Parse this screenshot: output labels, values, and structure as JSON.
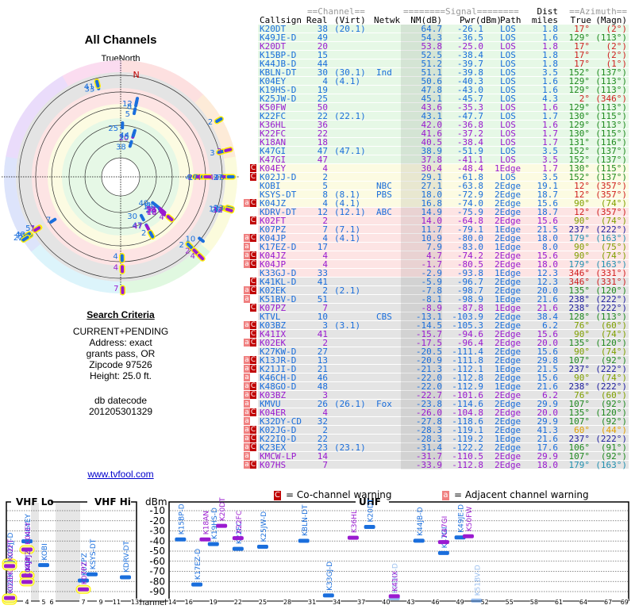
{
  "polar": {
    "title": "All Channels",
    "north_label": "TrueNorth",
    "magnetic_north_label": "N"
  },
  "criteria": {
    "heading": "Search Criteria",
    "lines": [
      "CURRENT+PENDING",
      "Address: exact",
      "grants pass, OR",
      "Zipcode 97526",
      "Height: 25.0 ft."
    ],
    "db_label": "db datecode",
    "db_value": "201205301329"
  },
  "site_link": "www.tvfool.com",
  "table_header": {
    "channel_group": "==Channel==",
    "signal_group": "========Signal========",
    "dist_top": "Dist",
    "azimuth_group": "==Azimuth==",
    "callsign": "Callsign",
    "real": "Real",
    "virt": "(Virt)",
    "netwk": "Netwk",
    "nm": "NM(dB)",
    "pwr": "Pwr(dBm)",
    "path": "Path",
    "dist": "miles",
    "true": "True",
    "magn": "(Magn)"
  },
  "colors": {
    "blue": "#1a6edc",
    "purple": "#9a1ad0",
    "green_zone": "#e6f8e6",
    "yellow_zone": "#fcfbe2",
    "pink_zone": "#fde4e4",
    "gray_zone": "#e4e4e4",
    "co_channel": "#c00000",
    "adjacent": "#f08080"
  },
  "stations": [
    {
      "call": "K20DT",
      "real": "38",
      "virt": "(20.1)",
      "net": "",
      "nm": "64.7",
      "pwr": "-26.1",
      "path": "LOS",
      "dist": "1.8",
      "az": "17°",
      "magn": "(2°)",
      "flags": "",
      "color": "blue"
    },
    {
      "call": "K49JE-D",
      "real": "49",
      "virt": "",
      "net": "",
      "nm": "54.3",
      "pwr": "-36.5",
      "path": "LOS",
      "dist": "1.6",
      "az": "129°",
      "magn": "(113°)",
      "flags": "",
      "color": "blue"
    },
    {
      "call": "K20DT",
      "real": "20",
      "virt": "",
      "net": "",
      "nm": "53.8",
      "pwr": "-25.0",
      "path": "LOS",
      "dist": "1.8",
      "az": "17°",
      "magn": "(2°)",
      "flags": "",
      "color": "purple"
    },
    {
      "call": "K15BP-D",
      "real": "15",
      "virt": "",
      "net": "",
      "nm": "52.5",
      "pwr": "-38.4",
      "path": "LOS",
      "dist": "1.8",
      "az": "17°",
      "magn": "(2°)",
      "flags": "",
      "color": "blue"
    },
    {
      "call": "K44JB-D",
      "real": "44",
      "virt": "",
      "net": "",
      "nm": "51.2",
      "pwr": "-39.7",
      "path": "LOS",
      "dist": "1.8",
      "az": "17°",
      "magn": "(1°)",
      "flags": "",
      "color": "blue"
    },
    {
      "call": "KBLN-DT",
      "real": "30",
      "virt": "(30.1)",
      "net": "Ind",
      "nm": "51.1",
      "pwr": "-39.8",
      "path": "LOS",
      "dist": "3.5",
      "az": "152°",
      "magn": "(137°)",
      "flags": "",
      "color": "blue"
    },
    {
      "call": "K04EY",
      "real": "4",
      "virt": "(4.1)",
      "net": "",
      "nm": "50.6",
      "pwr": "-40.3",
      "path": "LOS",
      "dist": "1.6",
      "az": "129°",
      "magn": "(113°)",
      "flags": "",
      "color": "blue"
    },
    {
      "call": "K19HS-D",
      "real": "19",
      "virt": "",
      "net": "",
      "nm": "47.8",
      "pwr": "-43.0",
      "path": "LOS",
      "dist": "1.6",
      "az": "129°",
      "magn": "(113°)",
      "flags": "",
      "color": "blue"
    },
    {
      "call": "K25JW-D",
      "real": "25",
      "virt": "",
      "net": "",
      "nm": "45.1",
      "pwr": "-45.7",
      "path": "LOS",
      "dist": "4.3",
      "az": "2°",
      "magn": "(346°)",
      "flags": "",
      "color": "blue"
    },
    {
      "call": "K50FW",
      "real": "50",
      "virt": "",
      "net": "",
      "nm": "43.6",
      "pwr": "-35.3",
      "path": "LOS",
      "dist": "1.6",
      "az": "129°",
      "magn": "(113°)",
      "flags": "",
      "color": "purple"
    },
    {
      "call": "K22FC",
      "real": "22",
      "virt": "(22.1)",
      "net": "",
      "nm": "43.1",
      "pwr": "-47.7",
      "path": "LOS",
      "dist": "1.7",
      "az": "130°",
      "magn": "(115°)",
      "flags": "",
      "color": "blue"
    },
    {
      "call": "K36HL",
      "real": "36",
      "virt": "",
      "net": "",
      "nm": "42.0",
      "pwr": "-36.8",
      "path": "LOS",
      "dist": "1.6",
      "az": "129°",
      "magn": "(113°)",
      "flags": "",
      "color": "purple"
    },
    {
      "call": "K22FC",
      "real": "22",
      "virt": "",
      "net": "",
      "nm": "41.6",
      "pwr": "-37.2",
      "path": "LOS",
      "dist": "1.7",
      "az": "130°",
      "magn": "(115°)",
      "flags": "",
      "color": "purple"
    },
    {
      "call": "K18AN",
      "real": "18",
      "virt": "",
      "net": "",
      "nm": "40.5",
      "pwr": "-38.4",
      "path": "LOS",
      "dist": "1.7",
      "az": "131°",
      "magn": "(116°)",
      "flags": "",
      "color": "purple"
    },
    {
      "call": "K47GI",
      "real": "47",
      "virt": "(47.1)",
      "net": "",
      "nm": "38.9",
      "pwr": "-51.9",
      "path": "LOS",
      "dist": "3.5",
      "az": "152°",
      "magn": "(137°)",
      "flags": "",
      "color": "blue"
    },
    {
      "call": "K47GI",
      "real": "47",
      "virt": "",
      "net": "",
      "nm": "37.8",
      "pwr": "-41.1",
      "path": "LOS",
      "dist": "3.5",
      "az": "152°",
      "magn": "(137°)",
      "flags": "",
      "color": "purple"
    },
    {
      "call": "K04EY",
      "real": "4",
      "virt": "",
      "net": "",
      "nm": "30.4",
      "pwr": "-48.4",
      "path": "1Edge",
      "dist": "1.7",
      "az": "130°",
      "magn": "(115°)",
      "flags": "C",
      "color": "purple"
    },
    {
      "call": "K02JJ-D",
      "real": "2",
      "virt": "",
      "net": "",
      "nm": "29.1",
      "pwr": "-61.8",
      "path": "LOS",
      "dist": "3.5",
      "az": "152°",
      "magn": "(137°)",
      "flags": "C",
      "color": "blue"
    },
    {
      "call": "KOBI",
      "real": "5",
      "virt": "",
      "net": "NBC",
      "nm": "27.1",
      "pwr": "-63.8",
      "path": "2Edge",
      "dist": "19.1",
      "az": "12°",
      "magn": "(357°)",
      "flags": "",
      "color": "blue"
    },
    {
      "call": "KSYS-DT",
      "real": "8",
      "virt": "(8.1)",
      "net": "PBS",
      "nm": "18.0",
      "pwr": "-72.9",
      "path": "2Edge",
      "dist": "18.7",
      "az": "12°",
      "magn": "(357°)",
      "flags": "",
      "color": "blue"
    },
    {
      "call": "K04JZ",
      "real": "4",
      "virt": "(4.1)",
      "net": "",
      "nm": "16.8",
      "pwr": "-74.0",
      "path": "2Edge",
      "dist": "15.6",
      "az": "90°",
      "magn": "(74°)",
      "flags": "aC",
      "color": "blue"
    },
    {
      "call": "KDRV-DT",
      "real": "12",
      "virt": "(12.1)",
      "net": "ABC",
      "nm": "14.9",
      "pwr": "-75.9",
      "path": "2Edge",
      "dist": "18.7",
      "az": "12°",
      "magn": "(357°)",
      "flags": "",
      "color": "blue"
    },
    {
      "call": "K02FT",
      "real": "2",
      "virt": "",
      "net": "",
      "nm": "14.0",
      "pwr": "-64.8",
      "path": "2Edge",
      "dist": "15.6",
      "az": "90°",
      "magn": "(74°)",
      "flags": "C",
      "color": "purple"
    },
    {
      "call": "K07PZ",
      "real": "7",
      "virt": "(7.1)",
      "net": "",
      "nm": "11.7",
      "pwr": "-79.1",
      "path": "1Edge",
      "dist": "21.5",
      "az": "237°",
      "magn": "(222°)",
      "flags": "",
      "color": "blue"
    },
    {
      "call": "K04JP",
      "real": "4",
      "virt": "(4.1)",
      "net": "",
      "nm": "10.9",
      "pwr": "-80.0",
      "path": "2Edge",
      "dist": "18.0",
      "az": "179°",
      "magn": "(163°)",
      "flags": "aC",
      "color": "blue"
    },
    {
      "call": "K17EZ-D",
      "real": "17",
      "virt": "",
      "net": "",
      "nm": "7.9",
      "pwr": "-83.0",
      "path": "1Edge",
      "dist": "8.0",
      "az": "90°",
      "magn": "(75°)",
      "flags": "a",
      "color": "blue"
    },
    {
      "call": "K04JZ",
      "real": "4",
      "virt": "",
      "net": "",
      "nm": "4.7",
      "pwr": "-74.2",
      "path": "2Edge",
      "dist": "15.6",
      "az": "90°",
      "magn": "(74°)",
      "flags": "aC",
      "color": "purple"
    },
    {
      "call": "K04JP",
      "real": "4",
      "virt": "",
      "net": "",
      "nm": "-1.7",
      "pwr": "-80.5",
      "path": "2Edge",
      "dist": "18.0",
      "az": "179°",
      "magn": "(163°)",
      "flags": "aC",
      "color": "purple"
    },
    {
      "call": "K33GJ-D",
      "real": "33",
      "virt": "",
      "net": "",
      "nm": "-2.9",
      "pwr": "-93.8",
      "path": "1Edge",
      "dist": "12.3",
      "az": "346°",
      "magn": "(331°)",
      "flags": "",
      "color": "blue"
    },
    {
      "call": "K41KL-D",
      "real": "41",
      "virt": "",
      "net": "",
      "nm": "-5.9",
      "pwr": "-96.7",
      "path": "2Edge",
      "dist": "12.3",
      "az": "346°",
      "magn": "(331°)",
      "flags": "C",
      "color": "blue"
    },
    {
      "call": "K02EK",
      "real": "2",
      "virt": "(2.1)",
      "net": "",
      "nm": "-7.8",
      "pwr": "-98.7",
      "path": "2Edge",
      "dist": "20.0",
      "az": "135°",
      "magn": "(120°)",
      "flags": "aC",
      "color": "blue"
    },
    {
      "call": "K51BV-D",
      "real": "51",
      "virt": "",
      "net": "",
      "nm": "-8.1",
      "pwr": "-98.9",
      "path": "1Edge",
      "dist": "21.6",
      "az": "238°",
      "magn": "(222°)",
      "flags": "a",
      "color": "blue"
    },
    {
      "call": "K07PZ",
      "real": "7",
      "virt": "",
      "net": "",
      "nm": "-8.9",
      "pwr": "-87.8",
      "path": "1Edge",
      "dist": "21.6",
      "az": "238°",
      "magn": "(222°)",
      "flags": "C",
      "color": "purple"
    },
    {
      "call": "KTVL",
      "real": "10",
      "virt": "",
      "net": "CBS",
      "nm": "-13.1",
      "pwr": "-103.9",
      "path": "2Edge",
      "dist": "38.4",
      "az": "128°",
      "magn": "(113°)",
      "flags": "",
      "color": "blue"
    },
    {
      "call": "K03BZ",
      "real": "3",
      "virt": "(3.1)",
      "net": "",
      "nm": "-14.5",
      "pwr": "-105.3",
      "path": "2Edge",
      "dist": "6.2",
      "az": "76°",
      "magn": "(60°)",
      "flags": "aC",
      "color": "blue"
    },
    {
      "call": "K41IX",
      "real": "41",
      "virt": "",
      "net": "",
      "nm": "-15.7",
      "pwr": "-94.6",
      "path": "2Edge",
      "dist": "15.6",
      "az": "90°",
      "magn": "(74°)",
      "flags": "C",
      "color": "purple"
    },
    {
      "call": "K02EK",
      "real": "2",
      "virt": "",
      "net": "",
      "nm": "-17.5",
      "pwr": "-96.4",
      "path": "2Edge",
      "dist": "20.0",
      "az": "135°",
      "magn": "(120°)",
      "flags": "aC",
      "color": "purple"
    },
    {
      "call": "K27KW-D",
      "real": "27",
      "virt": "",
      "net": "",
      "nm": "-20.5",
      "pwr": "-111.4",
      "path": "2Edge",
      "dist": "15.6",
      "az": "90°",
      "magn": "(74°)",
      "flags": "",
      "color": "blue"
    },
    {
      "call": "K13JR-D",
      "real": "13",
      "virt": "",
      "net": "",
      "nm": "-20.9",
      "pwr": "-111.8",
      "path": "2Edge",
      "dist": "29.8",
      "az": "107°",
      "magn": "(92°)",
      "flags": "aC",
      "color": "blue"
    },
    {
      "call": "K21JI-D",
      "real": "21",
      "virt": "",
      "net": "",
      "nm": "-21.3",
      "pwr": "-112.1",
      "path": "1Edge",
      "dist": "21.5",
      "az": "237°",
      "magn": "(222°)",
      "flags": "aC",
      "color": "blue"
    },
    {
      "call": "K46CH-D",
      "real": "46",
      "virt": "",
      "net": "",
      "nm": "-22.0",
      "pwr": "-112.8",
      "path": "2Edge",
      "dist": "15.6",
      "az": "90°",
      "magn": "(74°)",
      "flags": "a",
      "color": "blue"
    },
    {
      "call": "K48GO-D",
      "real": "48",
      "virt": "",
      "net": "",
      "nm": "-22.0",
      "pwr": "-112.9",
      "path": "1Edge",
      "dist": "21.6",
      "az": "238°",
      "magn": "(222°)",
      "flags": "aC",
      "color": "blue"
    },
    {
      "call": "K03BZ",
      "real": "3",
      "virt": "",
      "net": "",
      "nm": "-22.7",
      "pwr": "-101.6",
      "path": "2Edge",
      "dist": "6.2",
      "az": "76°",
      "magn": "(60°)",
      "flags": "aC",
      "color": "purple"
    },
    {
      "call": "KMVU",
      "real": "26",
      "virt": "(26.1)",
      "net": "Fox",
      "nm": "-23.8",
      "pwr": "-114.6",
      "path": "2Edge",
      "dist": "29.9",
      "az": "107°",
      "magn": "(92°)",
      "flags": "a",
      "color": "blue"
    },
    {
      "call": "K04ER",
      "real": "4",
      "virt": "",
      "net": "",
      "nm": "-26.0",
      "pwr": "-104.8",
      "path": "2Edge",
      "dist": "20.0",
      "az": "135°",
      "magn": "(120°)",
      "flags": "aC",
      "color": "purple"
    },
    {
      "call": "K32DY-CD",
      "real": "32",
      "virt": "",
      "net": "",
      "nm": "-27.8",
      "pwr": "-118.6",
      "path": "2Edge",
      "dist": "29.9",
      "az": "107°",
      "magn": "(92°)",
      "flags": "a",
      "color": "blue"
    },
    {
      "call": "K02JG-D",
      "real": "2",
      "virt": "",
      "net": "",
      "nm": "-28.3",
      "pwr": "-119.1",
      "path": "2Edge",
      "dist": "41.3",
      "az": "60°",
      "magn": "(44°)",
      "flags": "aC",
      "color": "blue"
    },
    {
      "call": "K22IQ-D",
      "real": "22",
      "virt": "",
      "net": "",
      "nm": "-28.3",
      "pwr": "-119.2",
      "path": "1Edge",
      "dist": "21.6",
      "az": "237°",
      "magn": "(222°)",
      "flags": "aC",
      "color": "blue"
    },
    {
      "call": "K23EX",
      "real": "23",
      "virt": "(23.1)",
      "net": "",
      "nm": "-31.4",
      "pwr": "-122.2",
      "path": "2Edge",
      "dist": "17.6",
      "az": "106°",
      "magn": "(91°)",
      "flags": "aC",
      "color": "blue"
    },
    {
      "call": "KMCW-LP",
      "real": "14",
      "virt": "",
      "net": "",
      "nm": "-31.7",
      "pwr": "-110.5",
      "path": "2Edge",
      "dist": "29.9",
      "az": "107°",
      "magn": "(92°)",
      "flags": "a",
      "color": "purple"
    },
    {
      "call": "K07HS",
      "real": "7",
      "virt": "",
      "net": "",
      "nm": "-33.9",
      "pwr": "-112.8",
      "path": "2Edge",
      "dist": "18.0",
      "az": "179°",
      "magn": "(163°)",
      "flags": "aC",
      "color": "purple"
    }
  ],
  "legend": {
    "co_channel_symbol": "C",
    "co_channel_text": "= Co-channel warning",
    "adjacent_symbol": "a",
    "adjacent_text": "= Adjacent channel warning"
  },
  "chart_data": {
    "type": "scatter",
    "ylabel": "dBm",
    "xlabel": "Channel",
    "ylim": [
      -95,
      -5
    ],
    "yticks": [
      "-10",
      "-20",
      "-30",
      "-40",
      "-50",
      "-60",
      "-70",
      "-80",
      "-90"
    ],
    "panels": [
      {
        "label": "VHF Lo",
        "xticks": [
          "2",
          "4",
          "5",
          "6"
        ]
      },
      {
        "label": "VHF Hi",
        "xticks": [
          "7",
          "9",
          "11",
          "13"
        ]
      },
      {
        "label": "UHF",
        "xticks": [
          "14",
          "16",
          "19",
          "22",
          "25",
          "28",
          "31",
          "34",
          "37",
          "40",
          "43",
          "46",
          "49",
          "52",
          "55",
          "58",
          "61",
          "64",
          "67",
          "69"
        ]
      }
    ],
    "grid": true,
    "points_from": "stations (channel = Real, value = Pwr(dBm)), shown where Pwr > -100"
  }
}
